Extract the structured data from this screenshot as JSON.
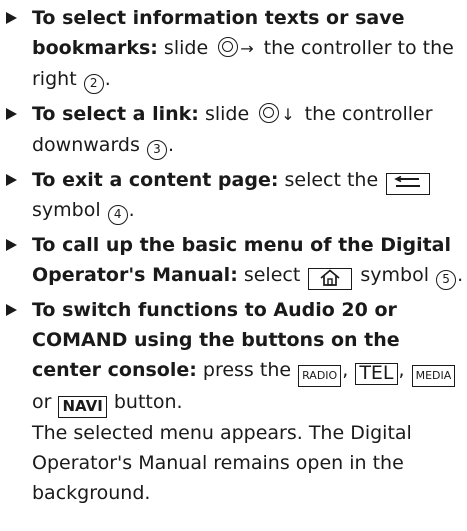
{
  "items": [
    {
      "title": "To select information texts or save bookmarks:",
      "text_before": "slide",
      "direction_arrow": "→",
      "text_after": "the controller to the right",
      "step": "2",
      "end": "."
    },
    {
      "title": "To select a link:",
      "text_before": "slide",
      "direction_arrow": "↓",
      "text_after": "the controller downwards",
      "step": "3",
      "end": "."
    },
    {
      "title": "To exit a content page:",
      "text_before": "select the",
      "symbol_icon": "back-arrow-icon",
      "text_after": "symbol",
      "step": "4",
      "end": "."
    },
    {
      "title": "To call up the basic menu of the Digital Operator's Manual:",
      "text_before": "select",
      "symbol_icon": "home-icon",
      "text_after": "symbol",
      "step": "5",
      "end": "."
    },
    {
      "title": "To switch functions to Audio 20 or COMAND using the buttons on the center console:",
      "text_before": "press the",
      "keys": [
        "RADIO",
        "TEL",
        "MEDIA",
        "NAVI"
      ],
      "separator_comma": ",",
      "or_word": "or",
      "text_after": "button.",
      "result": "The selected menu appears. The Digital Operator's Manual remains open in the background."
    }
  ]
}
